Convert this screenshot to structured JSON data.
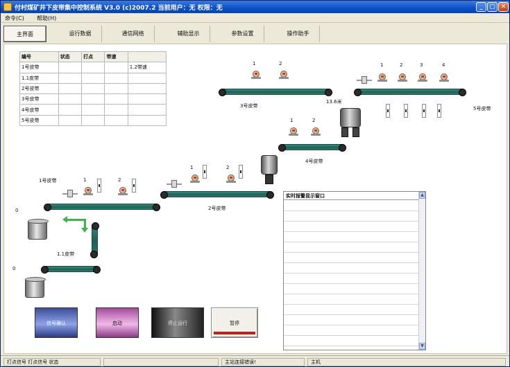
{
  "window": {
    "title": "付村煤矿井下皮带集中控制系统 V3.0 (c)2007.2  当前用户：无  权限：无",
    "buttons": {
      "minimize": "_",
      "maximize": "▢",
      "close": "✕"
    }
  },
  "menu": {
    "command": "命令(C)",
    "help": "帮助(H)"
  },
  "tabs": [
    "主界面",
    "运行数据",
    "通信网络",
    "辅助显示",
    "参数设置",
    "操作助手"
  ],
  "table": {
    "headers": [
      "编号",
      "状态",
      "打点",
      "带速",
      ""
    ],
    "rows": [
      [
        "1号皮带",
        "",
        "",
        "",
        "1.2带速"
      ],
      [
        "1.1皮带",
        "",
        "",
        "",
        ""
      ],
      [
        "2号皮带",
        "",
        "",
        "",
        ""
      ],
      [
        "3号皮带",
        "",
        "",
        "",
        ""
      ],
      [
        "4号皮带",
        "",
        "",
        "",
        ""
      ],
      [
        "5号皮带",
        "",
        "",
        "",
        ""
      ]
    ]
  },
  "belts": {
    "b1": "1号皮带",
    "b11": "1.1皮带",
    "b2": "2号皮带",
    "b3": "3号皮带",
    "b4": "4号皮带",
    "b5": "5号皮带"
  },
  "sensor_labels": {
    "one": "1",
    "two": "2",
    "three": "3",
    "four": "4"
  },
  "levels": {
    "bin1": "0",
    "bin2": "0",
    "hopper": "13.6米"
  },
  "alarm": {
    "title": "实时报警显示窗口"
  },
  "buttons": {
    "confirm": "信号确认",
    "start": "启动",
    "stop": "停止运行",
    "pause": "暂停"
  },
  "status": {
    "cell1": "打点信号 打点信号 状态",
    "cell2": "",
    "cell3": "主站连接错误!",
    "cell4": "主机"
  }
}
